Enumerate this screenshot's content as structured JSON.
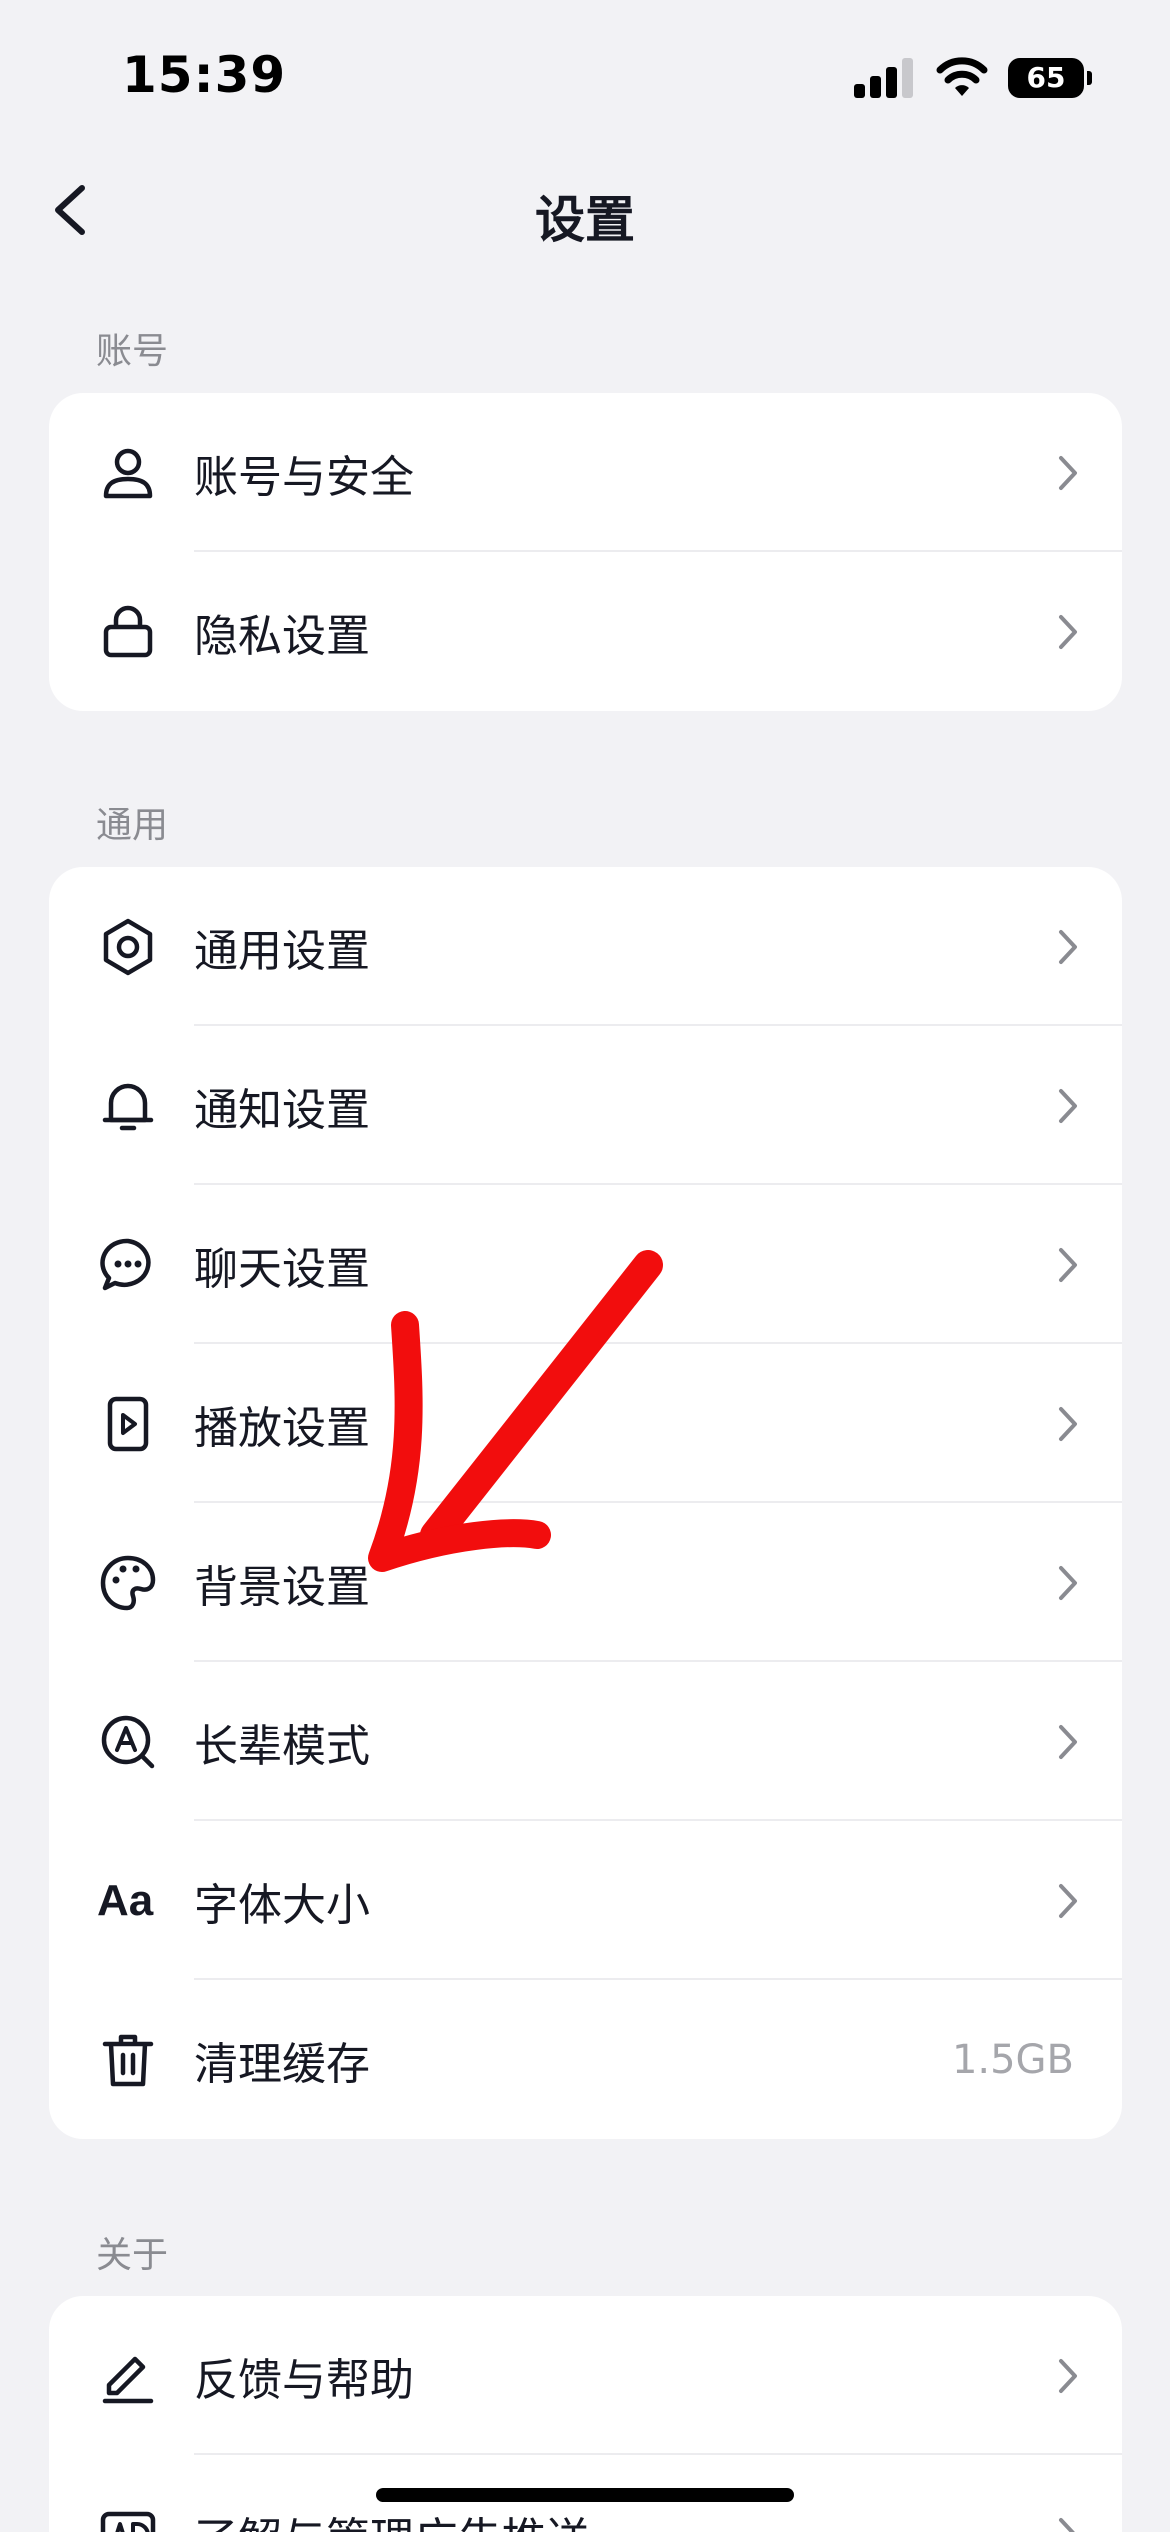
{
  "status_bar": {
    "time": "15:39",
    "battery": "65"
  },
  "nav": {
    "title": "设置"
  },
  "sections": [
    {
      "title": "账号",
      "items": [
        {
          "label": "账号与安全",
          "icon": "user-icon"
        },
        {
          "label": "隐私设置",
          "icon": "lock-icon"
        }
      ]
    },
    {
      "title": "通用",
      "items": [
        {
          "label": "通用设置",
          "icon": "gear-icon"
        },
        {
          "label": "通知设置",
          "icon": "bell-icon"
        },
        {
          "label": "聊天设置",
          "icon": "chat-bubble-icon"
        },
        {
          "label": "播放设置",
          "icon": "play-icon"
        },
        {
          "label": "背景设置",
          "icon": "palette-icon"
        },
        {
          "label": "长辈模式",
          "icon": "elder-mode-icon"
        },
        {
          "label": "字体大小",
          "icon": "font-size-icon",
          "icon_text": "Aa"
        },
        {
          "label": "清理缓存",
          "icon": "trash-icon",
          "value": "1.5GB"
        }
      ]
    },
    {
      "title": "关于",
      "items": [
        {
          "label": "反馈与帮助",
          "icon": "pencil-icon"
        },
        {
          "label": "了解与管理广告推送",
          "icon": "ad-icon"
        }
      ]
    }
  ],
  "colors": {
    "background": "#f2f2f5",
    "card": "#ffffff",
    "annotation": "#f20d0d",
    "secondary_text": "#8a8b91"
  }
}
